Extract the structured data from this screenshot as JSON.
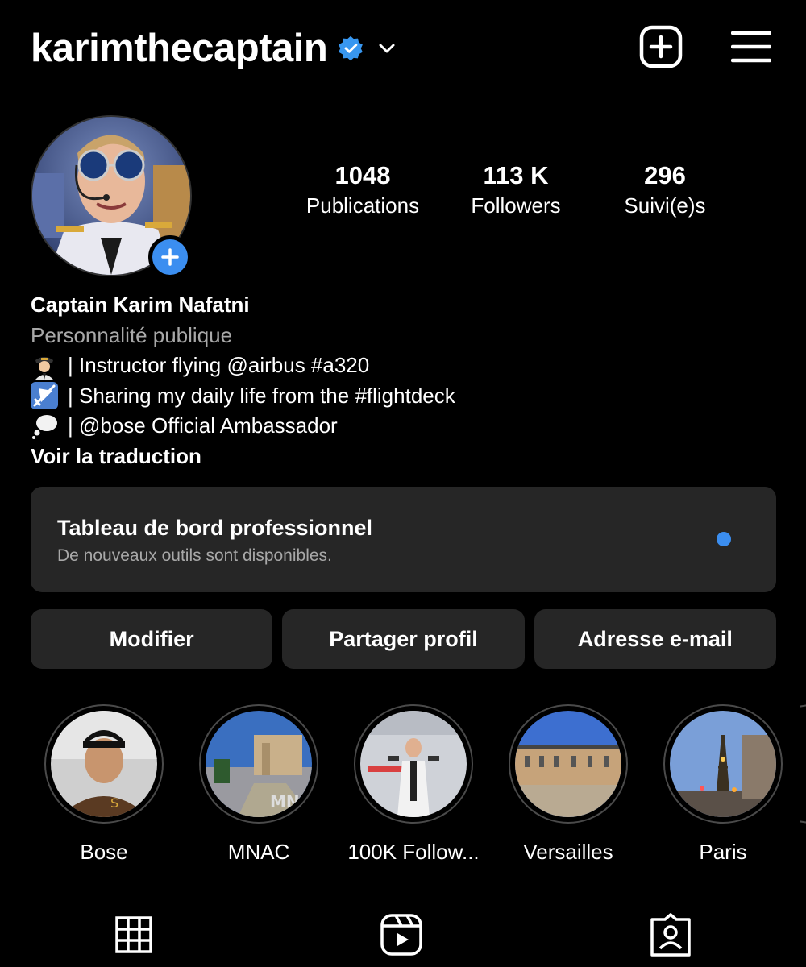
{
  "header": {
    "username": "karimthecaptain",
    "verified_icon": "verified-badge-icon",
    "dropdown_icon": "chevron-down-icon",
    "new_post_icon": "plus-square-icon",
    "menu_icon": "hamburger-menu-icon"
  },
  "stats": [
    {
      "value": "1048",
      "label": "Publications"
    },
    {
      "value": "113 K",
      "label": "Followers"
    },
    {
      "value": "296",
      "label": "Suivi(e)s"
    }
  ],
  "bio": {
    "name": "Captain Karim Nafatni",
    "category": "Personnalité publique",
    "lines": [
      {
        "icon": "pilot-emoji",
        "text": "| Instructor flying @airbus #a320"
      },
      {
        "icon": "airplane-emoji",
        "text": "| Sharing my daily life from the #flightdeck"
      },
      {
        "icon": "thought-bubble-emoji",
        "text": "| @bose Official Ambassador"
      }
    ],
    "translate": "Voir la traduction"
  },
  "dashboard": {
    "title": "Tableau de bord professionnel",
    "subtitle": "De nouveaux outils sont disponibles."
  },
  "actions": [
    "Modifier",
    "Partager profil",
    "Adresse e-mail"
  ],
  "highlights": [
    {
      "label": "Bose"
    },
    {
      "label": "MNAC"
    },
    {
      "label": "100K Follow..."
    },
    {
      "label": "Versailles"
    },
    {
      "label": "Paris"
    }
  ],
  "tabs": [
    "grid-icon",
    "reels-icon",
    "tagged-icon"
  ],
  "colors": {
    "accent": "#3b8ef0",
    "card": "#262626",
    "muted": "#a8a8a8"
  }
}
